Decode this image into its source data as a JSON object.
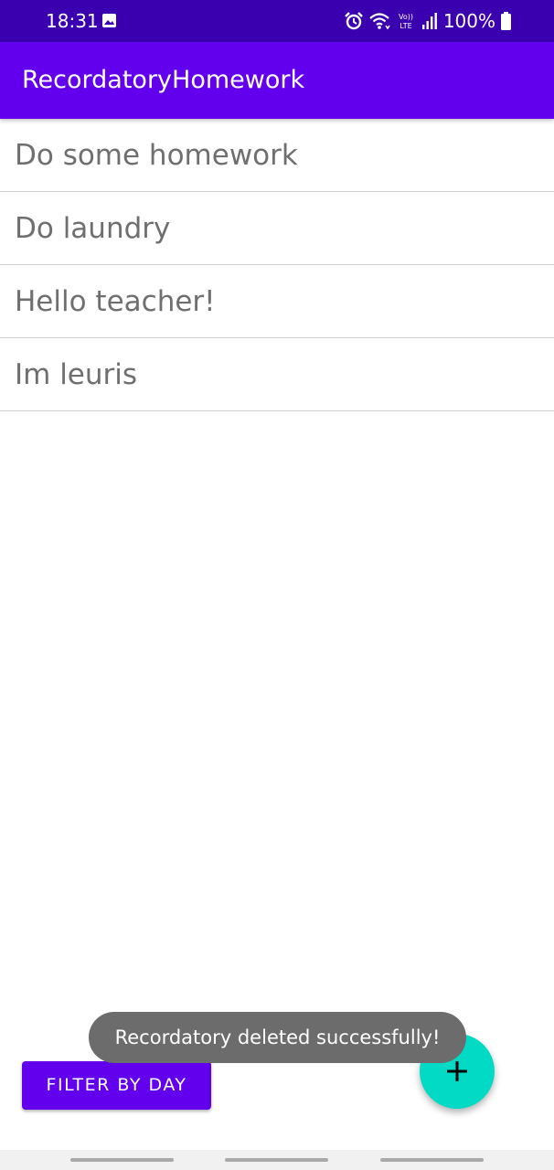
{
  "status_bar": {
    "time": "18:31",
    "battery": "100%",
    "icons": [
      "gallery-icon",
      "alarm-icon",
      "wifi-icon",
      "volte-icon",
      "signal-icon",
      "battery-icon"
    ],
    "volte_top": "Vo))",
    "volte_bottom": "LTE"
  },
  "app_bar": {
    "title": "RecordatoryHomework",
    "color": "#6200ee"
  },
  "list": {
    "items": [
      {
        "label": "Do some homework"
      },
      {
        "label": "Do laundry"
      },
      {
        "label": "Hello teacher!"
      },
      {
        "label": "Im leuris"
      }
    ]
  },
  "buttons": {
    "filter_label": "FILTER BY DAY",
    "fab_icon": "plus-icon",
    "fab_color": "#03dac5"
  },
  "toast": {
    "message": "Recordatory deleted successfully!"
  }
}
